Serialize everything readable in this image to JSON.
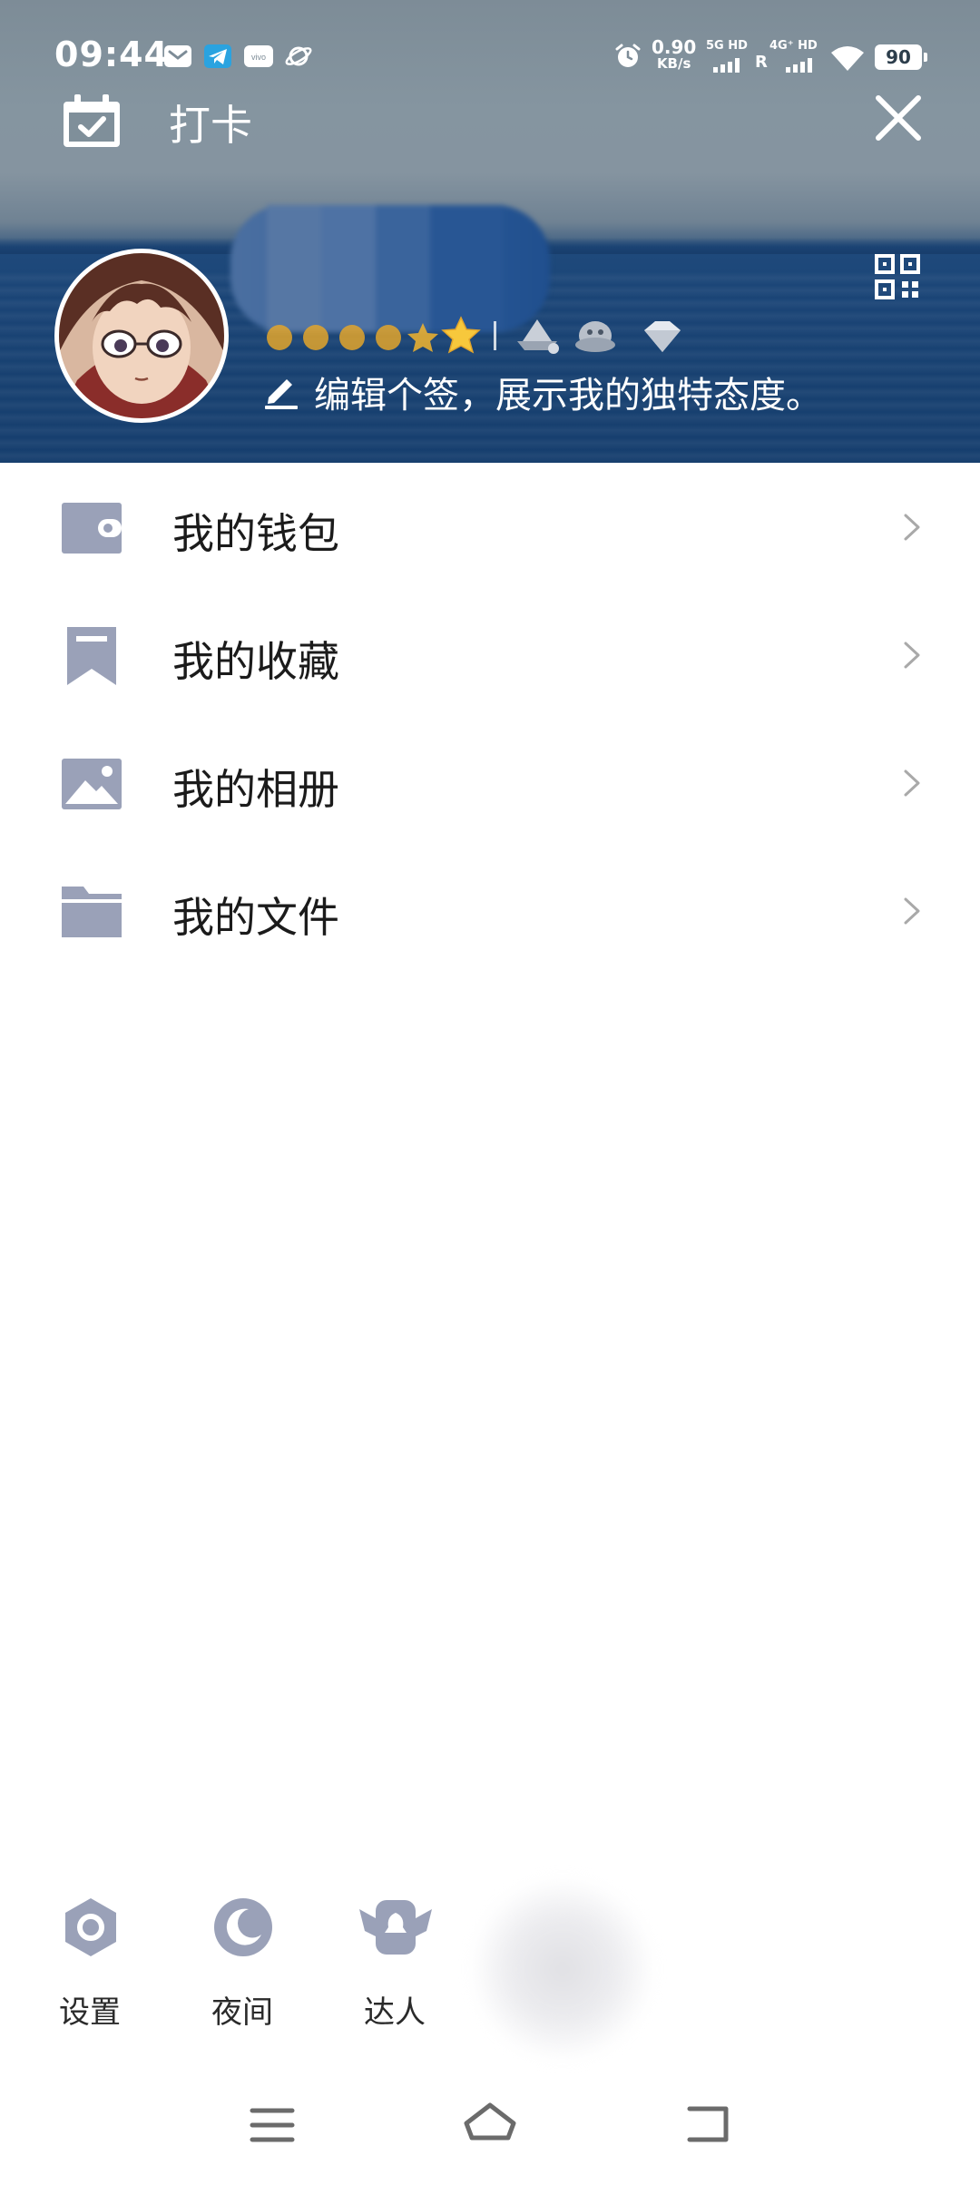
{
  "status_bar": {
    "time": "09:44",
    "net_speed_value": "0.90",
    "net_speed_unit": "KB/s",
    "sim1_label": "5G HD",
    "sim2_label": "4G⁺ HD",
    "roaming": "R",
    "battery": "90",
    "app_icons": [
      "mail-icon",
      "telegram-icon",
      "vivo-icon",
      "planet-icon"
    ],
    "indicator_icons": [
      "alarm-icon",
      "wifi-icon"
    ]
  },
  "header": {
    "checkin_label": "打卡",
    "checkin_icon": "calendar-check-icon",
    "close_icon": "close-icon",
    "qr_icon": "qr-code-icon",
    "signature": "编辑个签，展示我的独特态度。",
    "signature_icon": "edit-pencil-icon",
    "badges": [
      "sun-level-icon",
      "sun-level-icon",
      "sun-level-icon",
      "sun-level-icon",
      "star-level-icon",
      "star-level-icon",
      "ship-badge-icon",
      "penguin-badge-icon",
      "gem-badge-icon"
    ]
  },
  "menu": {
    "items": [
      {
        "label": "我的钱包",
        "icon": "wallet-icon"
      },
      {
        "label": "我的收藏",
        "icon": "bookmark-icon"
      },
      {
        "label": "我的相册",
        "icon": "image-icon"
      },
      {
        "label": "我的文件",
        "icon": "folder-icon"
      }
    ]
  },
  "bottom_tools": {
    "items": [
      {
        "label": "设置",
        "icon": "settings-hexagon-icon"
      },
      {
        "label": "夜间",
        "icon": "moon-icon"
      },
      {
        "label": "达人",
        "icon": "winged-badge-icon"
      }
    ]
  },
  "nav_bar": {
    "icons": [
      "menu-icon",
      "home-icon",
      "back-icon"
    ]
  },
  "colors": {
    "menu_icon": "#9aa1b8",
    "chevron": "#a9a9a9",
    "header_sky": "#8595a0",
    "header_sea": "#174070"
  }
}
